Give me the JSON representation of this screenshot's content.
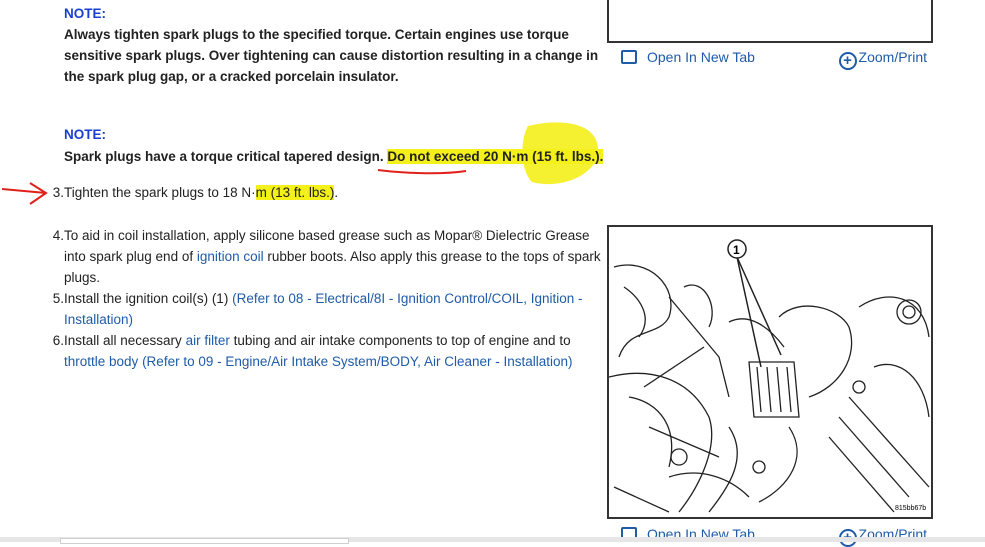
{
  "note1": {
    "label": "NOTE:",
    "text": "Always tighten spark plugs to the specified torque. Certain engines use torque sensitive spark plugs. Over tightening can cause distortion resulting in a change in the spark plug gap, or a cracked porcelain insulator."
  },
  "note2": {
    "label": "NOTE:",
    "text_plain": "Spark plugs have a torque critical tapered design. ",
    "text_highlight": "Do not exceed 20 N·m (15 ft. lbs.)."
  },
  "steps": [
    {
      "num": "3.",
      "text_a": "Tighten the spark plugs to 18 N·",
      "text_hl": "m (13 ft. lbs.)",
      "text_b": "."
    },
    {
      "num": "4.",
      "text_a": "To aid in coil installation, apply silicone based grease such as Mopar® Dielectric Grease into spark plug end of ",
      "link": "ignition coil",
      "text_b": " rubber boots. Also apply this grease to the tops of spark plugs."
    },
    {
      "num": "5.",
      "text_a": "Install the ignition coil(s) (1) ",
      "link": "(Refer to 08 - Electrical/8I - Ignition Control/COIL, Ignition - Installation)"
    },
    {
      "num": "6.",
      "text_a": "Install all necessary ",
      "link1": "air filter",
      "text_b": " tubing and air intake components to top of engine and to ",
      "link2": "throttle body",
      "text_c": " ",
      "link3": "(Refer to 09 - Engine/Air Intake System/BODY, Air Cleaner - Installation)"
    }
  ],
  "figure": {
    "open_label": "Open In New Tab",
    "zoom_label": "Zoom/Print",
    "callout": "1",
    "code": "815bb67b"
  },
  "colors": {
    "link": "#1f5ba8",
    "note": "#1a3fcf",
    "highlight": "#f4f01a",
    "annotation": "#e0201a"
  }
}
